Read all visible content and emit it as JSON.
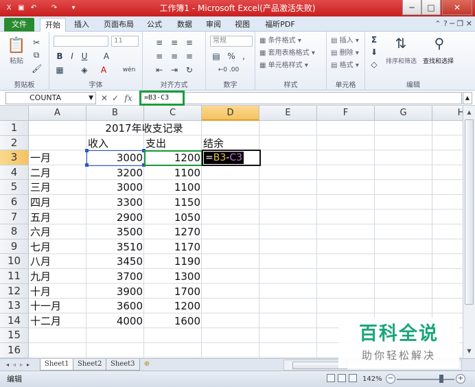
{
  "window": {
    "title": "工作簿1 - Microsoft Excel(产品激活失败)"
  },
  "menu": {
    "file": "文件",
    "tabs": [
      "开始",
      "插入",
      "页面布局",
      "公式",
      "数据",
      "审阅",
      "视图",
      "福昕PDF"
    ]
  },
  "ribbon": {
    "clipboard": {
      "label": "剪贴板",
      "paste": "粘贴"
    },
    "font": {
      "label": "字体",
      "size": "11",
      "bold": "B",
      "italic": "I",
      "underline": "U",
      "grow": "A",
      "wen": "wén"
    },
    "alignment": {
      "label": "对齐方式"
    },
    "number": {
      "label": "数字",
      "format": "常规",
      "percent": "%",
      "comma": ","
    },
    "styles": {
      "label": "样式",
      "conditional": "条件格式",
      "table": "套用表格格式",
      "cell_styles": "单元格样式"
    },
    "cells": {
      "label": "单元格",
      "insert": "插入",
      "delete": "删除",
      "format": "格式"
    },
    "editing": {
      "label": "编辑",
      "sort": "排序和筛选",
      "find": "查找和选择"
    }
  },
  "formula_bar": {
    "name_box": "COUNTA",
    "cancel": "✕",
    "enter": "✓",
    "fx": "fx",
    "formula": "=B3-C3"
  },
  "grid": {
    "columns": [
      "A",
      "B",
      "C",
      "D",
      "E",
      "F",
      "G",
      "H"
    ],
    "selected_column": "D",
    "selected_row": 3,
    "rows": [
      1,
      2,
      3,
      4,
      5,
      6,
      7,
      8,
      9,
      10,
      11,
      12,
      13,
      14,
      15,
      16
    ],
    "title": "2017年收支记录",
    "headers": {
      "income": "收入",
      "expense": "支出",
      "balance": "结余"
    },
    "records": [
      {
        "month": "一月",
        "income": 3000,
        "expense": 1200
      },
      {
        "month": "二月",
        "income": 3200,
        "expense": 1100
      },
      {
        "month": "三月",
        "income": 3000,
        "expense": 1100
      },
      {
        "month": "四月",
        "income": 3300,
        "expense": 1150
      },
      {
        "month": "五月",
        "income": 2900,
        "expense": 1050
      },
      {
        "month": "六月",
        "income": 3500,
        "expense": 1270
      },
      {
        "month": "七月",
        "income": 3510,
        "expense": 1170
      },
      {
        "month": "八月",
        "income": 3450,
        "expense": 1190
      },
      {
        "month": "九月",
        "income": 3700,
        "expense": 1300
      },
      {
        "month": "十月",
        "income": 3900,
        "expense": 1700
      },
      {
        "month": "十一月",
        "income": 3600,
        "expense": 1200
      },
      {
        "month": "十二月",
        "income": 4000,
        "expense": 1600
      }
    ],
    "editing_cell": {
      "eq": "=",
      "ref1": "B3",
      "op": "-",
      "ref2": "C3"
    }
  },
  "sheets": [
    "Sheet1",
    "Sheet2",
    "Sheet3"
  ],
  "active_sheet": "Sheet1",
  "status": {
    "mode": "编辑",
    "zoom": "142%",
    "minus": "−",
    "plus": "+"
  },
  "watermark": {
    "main": "百科全说",
    "sub": "助你轻松解决"
  },
  "colors": {
    "title_bar": "#c81e1e",
    "file_tab": "#2a8a2f",
    "formula_highlight": "#1c9c3a",
    "ref_b3": "#2a56c6",
    "ref_c3": "#1c9c3a",
    "selected_header": "#f5c262",
    "watermark": "#1aa67a"
  }
}
